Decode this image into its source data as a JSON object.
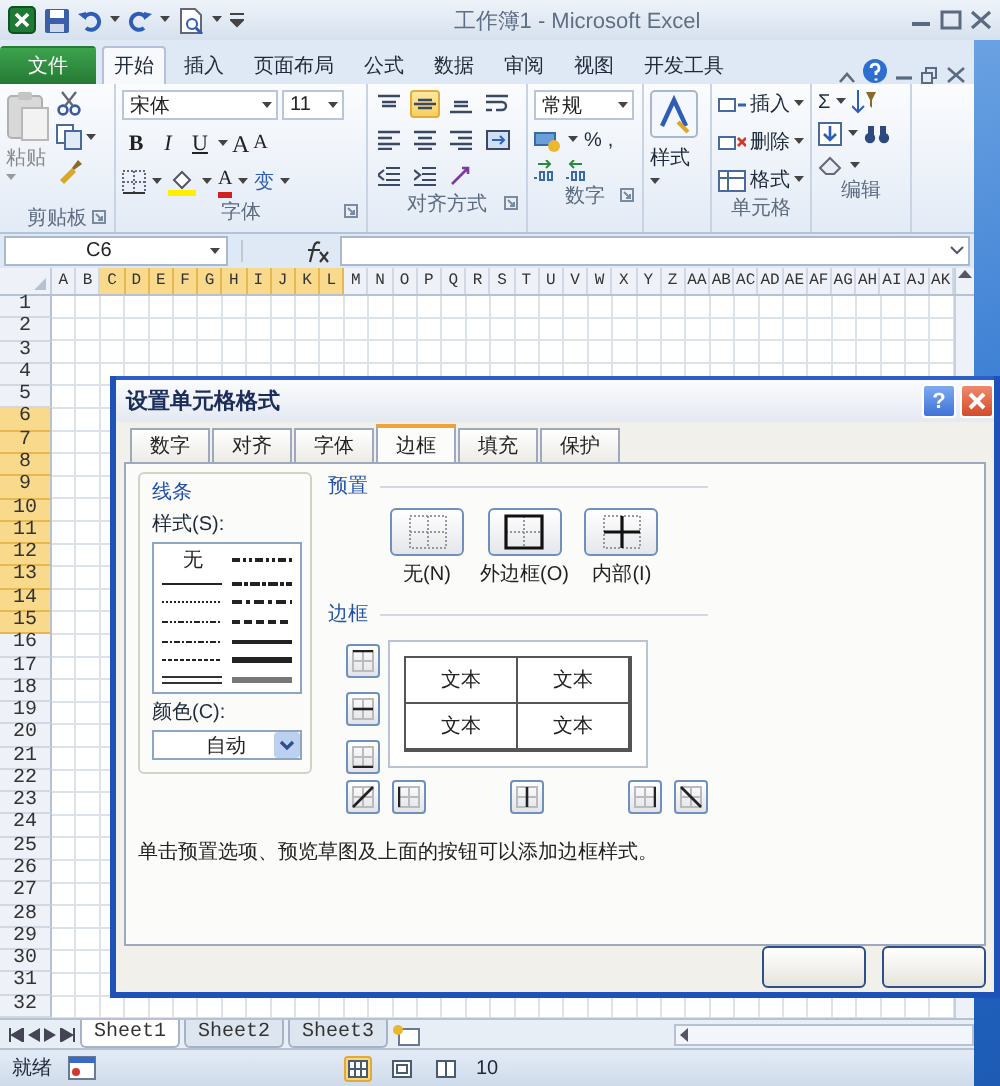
{
  "window": {
    "title": "工作簿1 - Microsoft Excel"
  },
  "ribbon_tabs": [
    {
      "label": "文件",
      "kind": "file",
      "selected": false
    },
    {
      "label": "开始",
      "kind": "tab",
      "selected": true
    },
    {
      "label": "插入",
      "kind": "tab",
      "selected": false
    },
    {
      "label": "页面布局",
      "kind": "tab",
      "selected": false
    },
    {
      "label": "公式",
      "kind": "tab",
      "selected": false
    },
    {
      "label": "数据",
      "kind": "tab",
      "selected": false
    },
    {
      "label": "审阅",
      "kind": "tab",
      "selected": false
    },
    {
      "label": "视图",
      "kind": "tab",
      "selected": false
    },
    {
      "label": "开发工具",
      "kind": "tab",
      "selected": false
    }
  ],
  "ribbon": {
    "clipboard": {
      "label": "剪贴板",
      "paste": "粘贴"
    },
    "font": {
      "label": "字体",
      "name": "宋体",
      "size": "11",
      "styles": [
        {
          "kind": "bold",
          "label": "B"
        },
        {
          "kind": "italic",
          "label": "I"
        },
        {
          "kind": "underline",
          "label": "U"
        }
      ],
      "size_buttons": [
        "A",
        "A"
      ],
      "font_color": "A",
      "phonetic": "变"
    },
    "alignment": {
      "label": "对齐方式",
      "buttons": [
        {
          "kind": "top",
          "selected": false
        },
        {
          "kind": "middle",
          "selected": true
        },
        {
          "kind": "bottom",
          "selected": false
        },
        {
          "kind": "wrap",
          "selected": false
        },
        {
          "kind": "left",
          "selected": false
        },
        {
          "kind": "center",
          "selected": false
        },
        {
          "kind": "right",
          "selected": false
        },
        {
          "kind": "merge",
          "selected": false
        },
        {
          "kind": "outdent",
          "selected": false
        },
        {
          "kind": "indent",
          "selected": false
        },
        {
          "kind": "orientation",
          "selected": false
        }
      ]
    },
    "number": {
      "label": "数字",
      "format": "常规",
      "percent": "%",
      "comma": ","
    },
    "styles": {
      "button": "样式"
    },
    "cells": {
      "label": "单元格",
      "items": [
        {
          "kind": "insert",
          "label": "插入"
        },
        {
          "kind": "delete",
          "label": "删除"
        },
        {
          "kind": "format",
          "label": "格式"
        }
      ]
    },
    "editing": {
      "label": "编辑",
      "sum": "Σ"
    }
  },
  "formula_bar": {
    "name_box": "C6"
  },
  "sheet": {
    "columns": [
      {
        "label": "A",
        "selected": false
      },
      {
        "label": "B",
        "selected": false
      },
      {
        "label": "C",
        "selected": true
      },
      {
        "label": "D",
        "selected": true
      },
      {
        "label": "E",
        "selected": true
      },
      {
        "label": "F",
        "selected": true
      },
      {
        "label": "G",
        "selected": true
      },
      {
        "label": "H",
        "selected": true
      },
      {
        "label": "I",
        "selected": true
      },
      {
        "label": "J",
        "selected": true
      },
      {
        "label": "K",
        "selected": true
      },
      {
        "label": "L",
        "selected": true
      },
      {
        "label": "M",
        "selected": false
      },
      {
        "label": "N",
        "selected": false
      },
      {
        "label": "O",
        "selected": false
      },
      {
        "label": "P",
        "selected": false
      },
      {
        "label": "Q",
        "selected": false
      },
      {
        "label": "R",
        "selected": false
      },
      {
        "label": "S",
        "selected": false
      },
      {
        "label": "T",
        "selected": false
      },
      {
        "label": "U",
        "selected": false
      },
      {
        "label": "V",
        "selected": false
      },
      {
        "label": "W",
        "selected": false
      },
      {
        "label": "X",
        "selected": false
      },
      {
        "label": "Y",
        "selected": false
      },
      {
        "label": "Z",
        "selected": false
      },
      {
        "label": "AA",
        "selected": false
      },
      {
        "label": "AB",
        "selected": false
      },
      {
        "label": "AC",
        "selected": false
      },
      {
        "label": "AD",
        "selected": false
      },
      {
        "label": "AE",
        "selected": false
      },
      {
        "label": "AF",
        "selected": false
      },
      {
        "label": "AG",
        "selected": false
      },
      {
        "label": "AH",
        "selected": false
      },
      {
        "label": "AI",
        "selected": false
      },
      {
        "label": "AJ",
        "selected": false
      },
      {
        "label": "AK",
        "selected": false
      }
    ],
    "rows": [
      {
        "label": "1",
        "selected": false
      },
      {
        "label": "2",
        "selected": false
      },
      {
        "label": "3",
        "selected": false
      },
      {
        "label": "4",
        "selected": false
      },
      {
        "label": "5",
        "selected": false
      },
      {
        "label": "6",
        "selected": true
      },
      {
        "label": "7",
        "selected": true
      },
      {
        "label": "8",
        "selected": true
      },
      {
        "label": "9",
        "selected": true
      },
      {
        "label": "10",
        "selected": true
      },
      {
        "label": "11",
        "selected": true
      },
      {
        "label": "12",
        "selected": true
      },
      {
        "label": "13",
        "selected": true
      },
      {
        "label": "14",
        "selected": true
      },
      {
        "label": "15",
        "selected": true
      },
      {
        "label": "16",
        "selected": false
      },
      {
        "label": "17",
        "selected": false
      },
      {
        "label": "18",
        "selected": false
      },
      {
        "label": "19",
        "selected": false
      },
      {
        "label": "20",
        "selected": false
      },
      {
        "label": "21",
        "selected": false
      },
      {
        "label": "22",
        "selected": false
      },
      {
        "label": "23",
        "selected": false
      },
      {
        "label": "24",
        "selected": false
      },
      {
        "label": "25",
        "selected": false
      },
      {
        "label": "26",
        "selected": false
      },
      {
        "label": "27",
        "selected": false
      },
      {
        "label": "28",
        "selected": false
      },
      {
        "label": "29",
        "selected": false
      },
      {
        "label": "30",
        "selected": false
      },
      {
        "label": "31",
        "selected": false
      },
      {
        "label": "32",
        "selected": false
      }
    ]
  },
  "sheet_tabs": [
    {
      "label": "Sheet1",
      "selected": true
    },
    {
      "label": "Sheet2",
      "selected": false
    },
    {
      "label": "Sheet3",
      "selected": false
    }
  ],
  "status_bar": {
    "status": "就绪",
    "views": [
      {
        "kind": "normal",
        "selected": true
      },
      {
        "kind": "layout",
        "selected": false
      },
      {
        "kind": "pagebreak",
        "selected": false
      }
    ],
    "zoom": "10"
  },
  "dialog": {
    "title": "设置单元格格式",
    "help": "?",
    "tabs": [
      {
        "label": "数字",
        "selected": false
      },
      {
        "label": "对齐",
        "selected": false
      },
      {
        "label": "字体",
        "selected": false
      },
      {
        "label": "边框",
        "selected": true
      },
      {
        "label": "填充",
        "selected": false
      },
      {
        "label": "保护",
        "selected": false
      }
    ],
    "line_group": {
      "label": "线条",
      "style_label": "样式(S):",
      "styles": [
        {
          "kind": "none",
          "label": "无"
        },
        {
          "kind": "mediumDashDotDot"
        },
        {
          "kind": "thin"
        },
        {
          "kind": "slantDashDot"
        },
        {
          "kind": "hair"
        },
        {
          "kind": "mediumDashDot"
        },
        {
          "kind": "dashDotDot"
        },
        {
          "kind": "mediumDashed"
        },
        {
          "kind": "dashDot"
        },
        {
          "kind": "medium"
        },
        {
          "kind": "dashed"
        },
        {
          "kind": "thick"
        },
        {
          "kind": "double"
        },
        {
          "kind": "thickGrey"
        }
      ],
      "color_label": "颜色(C):",
      "color_value": "自动"
    },
    "presets": {
      "label": "预置",
      "buttons": [
        {
          "kind": "none",
          "label": "无(N)"
        },
        {
          "kind": "outline",
          "label": "外边框(O)"
        },
        {
          "kind": "inside",
          "label": "内部(I)"
        }
      ]
    },
    "border": {
      "label": "边框",
      "preview_cells": [
        "文本",
        "文本",
        "文本",
        "文本"
      ]
    },
    "hint": "单击预置选项、预览草图及上面的按钮可以添加边框样式。"
  }
}
